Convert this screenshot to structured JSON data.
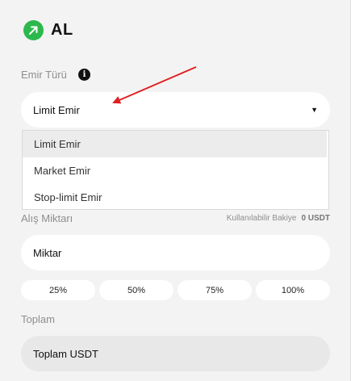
{
  "header": {
    "title": "AL",
    "icon": "arrow-up-right-icon",
    "accent": "#2db84d"
  },
  "order_type": {
    "label": "Emir Türü",
    "info_icon": "info-icon",
    "selected": "Limit Emir",
    "options": [
      "Limit Emir",
      "Market Emir",
      "Stop-limit Emir"
    ],
    "annotation_color": "#e02020"
  },
  "buy_amount": {
    "label": "Alış Miktarı",
    "balance_label": "Kullanılabilir Bakiye",
    "balance_value": "0 USDT",
    "placeholder": "Miktar"
  },
  "percent_buttons": [
    "25%",
    "50%",
    "75%",
    "100%"
  ],
  "total": {
    "label": "Toplam",
    "placeholder": "Toplam USDT"
  }
}
